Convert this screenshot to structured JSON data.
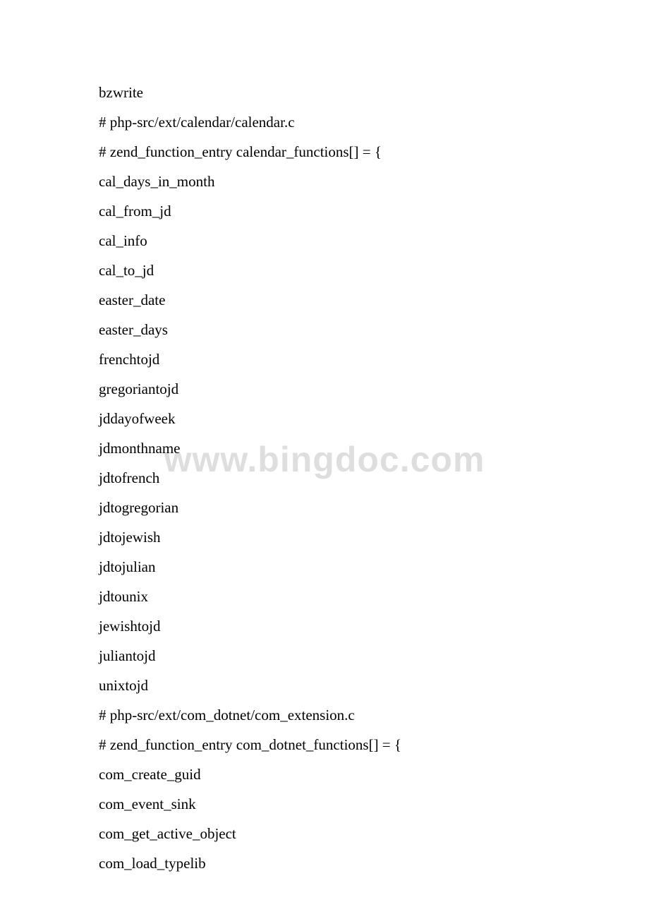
{
  "watermark": "www.bingdoc.com",
  "lines": [
    "bzwrite",
    "# php-src/ext/calendar/calendar.c",
    "# zend_function_entry calendar_functions[] = {",
    "cal_days_in_month",
    "cal_from_jd",
    "cal_info",
    "cal_to_jd",
    "easter_date",
    "easter_days",
    "frenchtojd",
    "gregoriantojd",
    "jddayofweek",
    "jdmonthname",
    "jdtofrench",
    "jdtogregorian",
    "jdtojewish",
    "jdtojulian",
    "jdtounix",
    "jewishtojd",
    "juliantojd",
    "unixtojd",
    "# php-src/ext/com_dotnet/com_extension.c",
    "# zend_function_entry com_dotnet_functions[] = {",
    "com_create_guid",
    "com_event_sink",
    "com_get_active_object",
    "com_load_typelib"
  ]
}
